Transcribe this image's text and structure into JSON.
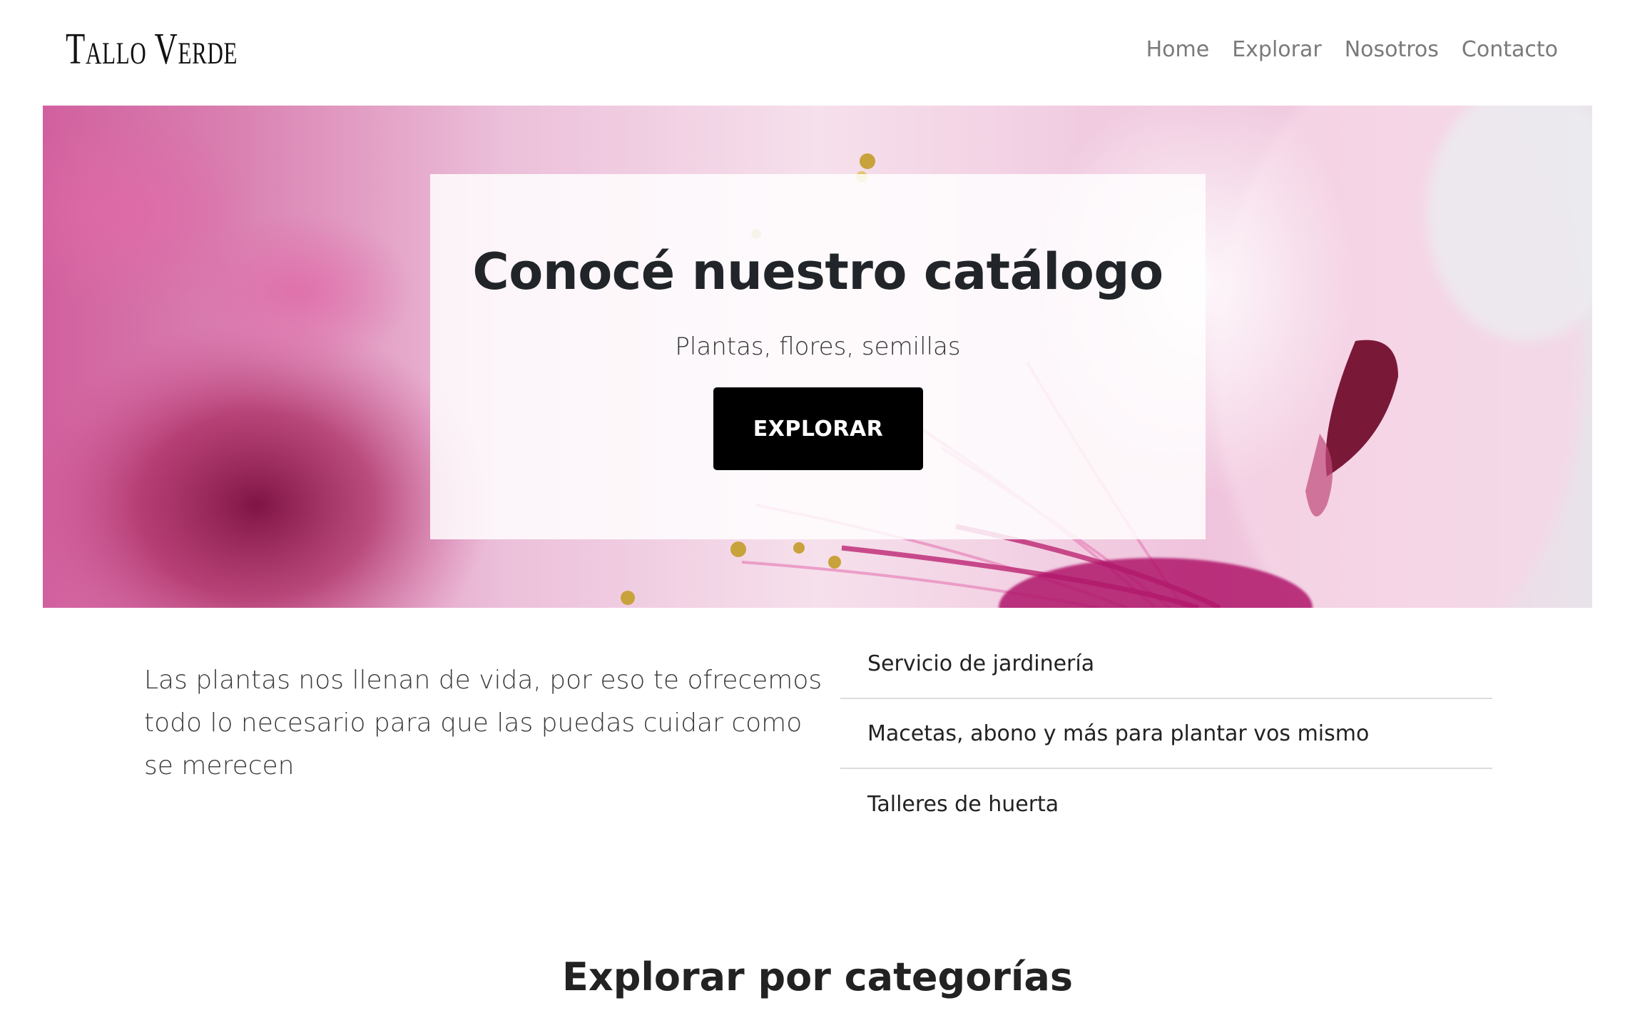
{
  "navbar": {
    "brand": "Tallo Verde",
    "links": [
      "Home",
      "Explorar",
      "Nosotros",
      "Contacto"
    ]
  },
  "hero": {
    "title": "Conocé nuestro catálogo",
    "subtitle": "Plantas, flores, semillas",
    "button_label": "EXPLORAR",
    "background_image": "pink-flower-closeup"
  },
  "intro": {
    "text": "Las plantas nos llenan de vida, por eso te ofrecemos todo lo necesario para que las puedas cuidar como se merecen"
  },
  "services": [
    "Servicio de jardinería",
    "Macetas, abono y más para plantar vos mismo",
    "Talleres de huerta"
  ],
  "categories": {
    "title": "Explorar por categorías"
  },
  "colors": {
    "accent": "#000000",
    "nav_text": "#7a7a7a",
    "hero_pink": "#e8a6c8",
    "magenta": "#b0146a"
  }
}
